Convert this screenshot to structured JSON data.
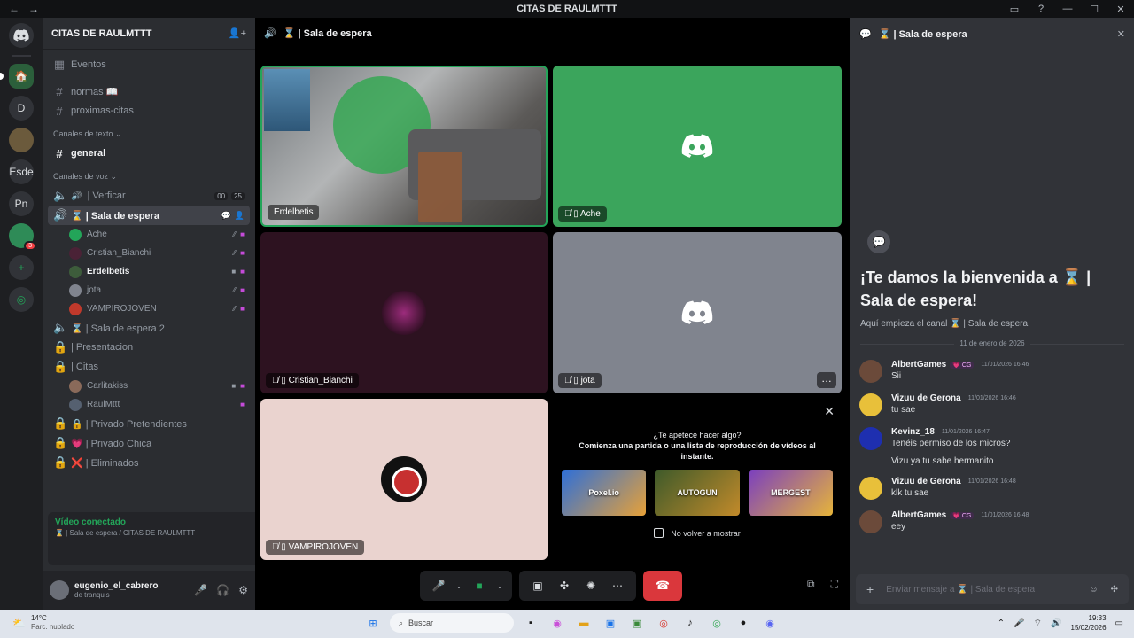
{
  "window": {
    "title": "CITAS DE RAULMTTT",
    "back": "←",
    "forward": "→",
    "controls": [
      "▭",
      "?",
      "—",
      "☐",
      "✕"
    ]
  },
  "rail": {
    "servers": [
      {
        "label": "D",
        "name": "server-d"
      },
      {
        "label": "Esde",
        "name": "server-esde"
      },
      {
        "label": "Pn",
        "name": "server-pn"
      }
    ],
    "badge": "3",
    "add": "+",
    "discover": "◎"
  },
  "server": {
    "name": "CITAS DE RAULMTTT",
    "events": "Eventos",
    "channels_top": [
      {
        "name": "normas 📖"
      },
      {
        "name": "proximas-citas"
      }
    ],
    "text_category": "Canales de texto",
    "general": "general",
    "voice_category": "Canales de voz",
    "verify": {
      "name": "| Verficar",
      "count_a": "00",
      "count_b": "25"
    },
    "waiting": "⌛ | Sala de espera",
    "waiting_users": [
      {
        "name": "Ache",
        "bold": false,
        "color": "#23a559"
      },
      {
        "name": "Cristian_Bianchi",
        "bold": false,
        "color": "#4a2236"
      },
      {
        "name": "Erdelbetis",
        "bold": true,
        "color": "#3d5c3b"
      },
      {
        "name": "jota",
        "bold": false,
        "color": "#80848e"
      },
      {
        "name": "VAMPIROJOVEN",
        "bold": false,
        "color": "#c0392b"
      }
    ],
    "more_channels": [
      {
        "name": "⌛ | Sala de espera 2",
        "icon": "🔊"
      },
      {
        "name": "| Presentacion",
        "icon": "🔒"
      },
      {
        "name": "| Citas",
        "icon": "🔒"
      }
    ],
    "citas_users": [
      "Carlitakiss",
      "RaulMttt"
    ],
    "private_channels": [
      {
        "name": "🔒 | Privado Pretendientes",
        "emoji": "🔒"
      },
      {
        "name": "💗 | Privado Chica",
        "emoji": "💗"
      },
      {
        "name": "❌ | Eliminados",
        "emoji": "❌"
      }
    ]
  },
  "voice": {
    "status": "Vídeo conectado",
    "location": "⌛ | Sala de espera / CITAS DE RAULMTTT"
  },
  "user": {
    "name": "eugenio_el_cabrero",
    "status": "de tranquis"
  },
  "stage": {
    "channel": "⌛ | Sala de espera",
    "tiles": {
      "erdel": "Erdelbetis",
      "ache": "Ache",
      "cristian": "Cristian_Bianchi",
      "jota": "jota",
      "vamp": "VAMPIROJOVEN"
    },
    "activity": {
      "question": "¿Te apetece hacer algo?",
      "desc": "Comienza una partida o una lista de reproducción de vídeos al instante.",
      "games": [
        "Poxel.io",
        "AUTOGUN",
        "MERGEST"
      ],
      "no_more": "No volver a mostrar"
    }
  },
  "chat": {
    "header": "⌛ | Sala de espera",
    "welcome_title": "¡Te damos la bienvenida a ⌛ | Sala de espera!",
    "welcome_sub": "Aquí empieza el canal ⌛ | Sala de espera.",
    "date": "11 de enero de 2026",
    "messages": [
      {
        "author": "AlbertGames",
        "tag": "💗 CG",
        "ts": "11/01/2026 16:46",
        "text": "Sii",
        "text2": "",
        "color": "#6b4a3a"
      },
      {
        "author": "Vizuu de Gerona",
        "tag": "",
        "ts": "11/01/2026 16:46",
        "text": "tu sae",
        "text2": "",
        "color": "#e8c03a"
      },
      {
        "author": "Kevinz_18",
        "tag": "",
        "ts": "11/01/2026 16:47",
        "text": "Tenéis permiso de los micros?",
        "text2": "Vizu ya tu sabe hermanito",
        "color": "#1e2fb0"
      },
      {
        "author": "Vizuu de Gerona",
        "tag": "",
        "ts": "11/01/2026 16:48",
        "text": "klk tu sae",
        "text2": "",
        "color": "#e8c03a"
      },
      {
        "author": "AlbertGames",
        "tag": "💗 CG",
        "ts": "11/01/2026 16:48",
        "text": "eey",
        "text2": "",
        "color": "#6b4a3a"
      }
    ],
    "input_placeholder": "Enviar mensaje a ⌛ | Sala de espera"
  },
  "taskbar": {
    "temp": "14°C",
    "weather": "Parc. nublado",
    "search": "Buscar",
    "time": "19:33",
    "date": "15/02/2026"
  },
  "colors": {
    "accent_green": "#23a559",
    "hangup_red": "#da373c",
    "blurple": "#5865f2"
  }
}
